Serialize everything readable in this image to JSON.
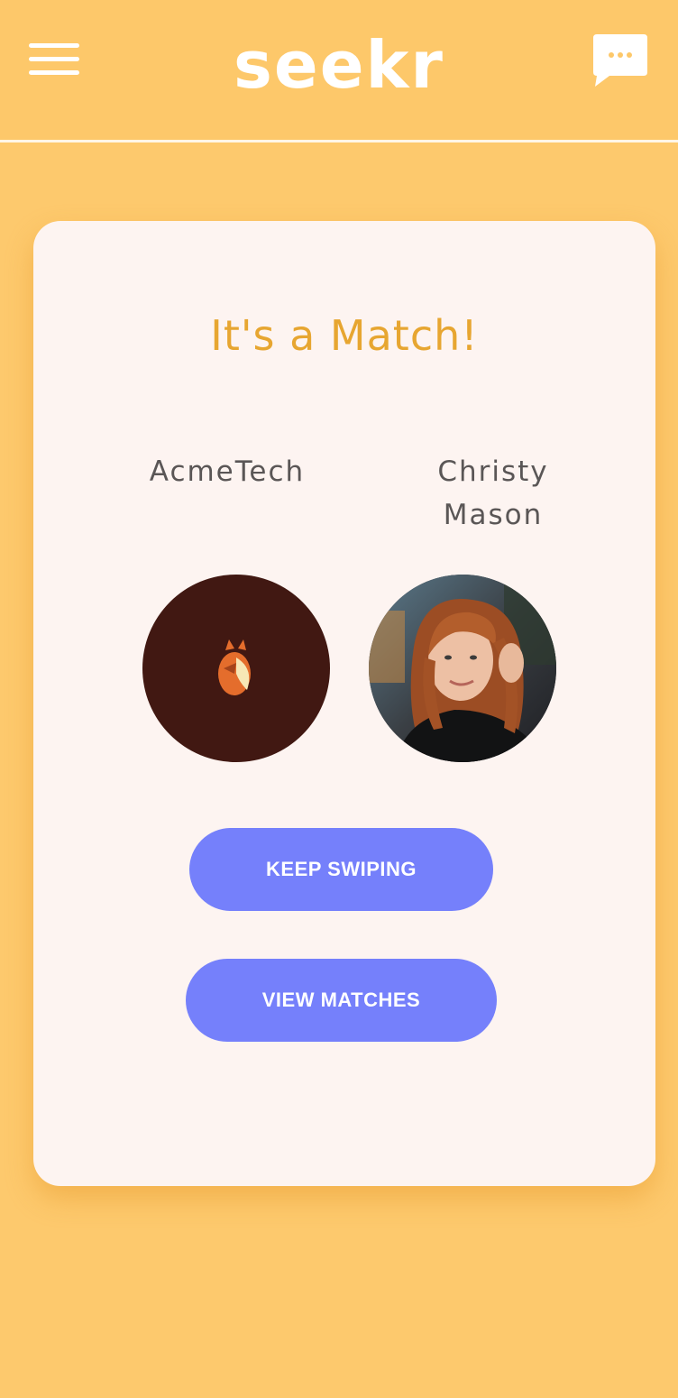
{
  "header": {
    "logo": "seekr",
    "menu_icon": "hamburger-menu-icon",
    "chat_icon": "chat-bubble-icon"
  },
  "match": {
    "title": "It's a Match!",
    "left_name": "AcmeTech",
    "right_name_line1": "Christy",
    "right_name_line2": "Mason",
    "left_avatar": "fox-logo-icon",
    "right_avatar": "profile-photo"
  },
  "actions": {
    "keep_swiping": "KEEP SWIPING",
    "view_matches": "VIEW MATCHES"
  },
  "colors": {
    "background": "#fdc96d",
    "accent_title": "#e7a631",
    "button": "#7580fb",
    "card": "#fdf4f1",
    "logo_avatar_bg": "#411812"
  }
}
